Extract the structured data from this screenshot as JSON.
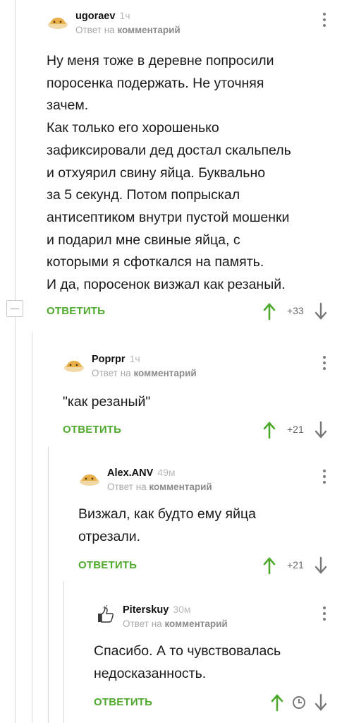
{
  "colors": {
    "accent": "#4ea92d",
    "muted": "#a9a9a9",
    "line": "#d8d8d8"
  },
  "icons": {
    "avatar": "default-cat-avatar",
    "avatar_thumb": "thumbs-up-avatar",
    "up": "arrow-up-icon",
    "down": "arrow-down-icon",
    "menu": "more-vertical-icon",
    "clock": "clock-icon",
    "collapse": "collapse-minus-icon"
  },
  "comments": [
    {
      "user": "ugoraev",
      "time": "1ч",
      "reply_prefix": "Ответ на",
      "reply_target": "комментарий",
      "text": "Ну меня тоже в деревне попросили\nпоросенка подержать. Не уточняя\nзачем.\nКак только его хорошенько\nзафиксировали дед достал скальпель\nи отхуярил свину яйца. Буквально\nза 5 секунд. Потом попрыскал\nантисептиком внутри пустой мошенки\nи подарил мне свиные яйца, с\nкоторыми я сфоткался на память.\nИ да, поросенок визжал как резаный.",
      "reply_label": "ОТВЕТИТЬ",
      "score": "+33"
    },
    {
      "user": "Poprpr",
      "time": "1ч",
      "reply_prefix": "Ответ на",
      "reply_target": "комментарий",
      "text": "\"как резаный\"",
      "reply_label": "ОТВЕТИТЬ",
      "score": "+21"
    },
    {
      "user": "Alex.ANV",
      "time": "49м",
      "reply_prefix": "Ответ на",
      "reply_target": "комментарий",
      "text": "Визжал, как будто ему яйца\nотрезали.",
      "reply_label": "ОТВЕТИТЬ",
      "score": "+21"
    },
    {
      "user": "Piterskuy",
      "time": "30м",
      "reply_prefix": "Ответ на",
      "reply_target": "комментарий",
      "text": "Спасибо. А то чувствовалась\nнедосказанность.",
      "reply_label": "ОТВЕТИТЬ",
      "score": ""
    }
  ]
}
